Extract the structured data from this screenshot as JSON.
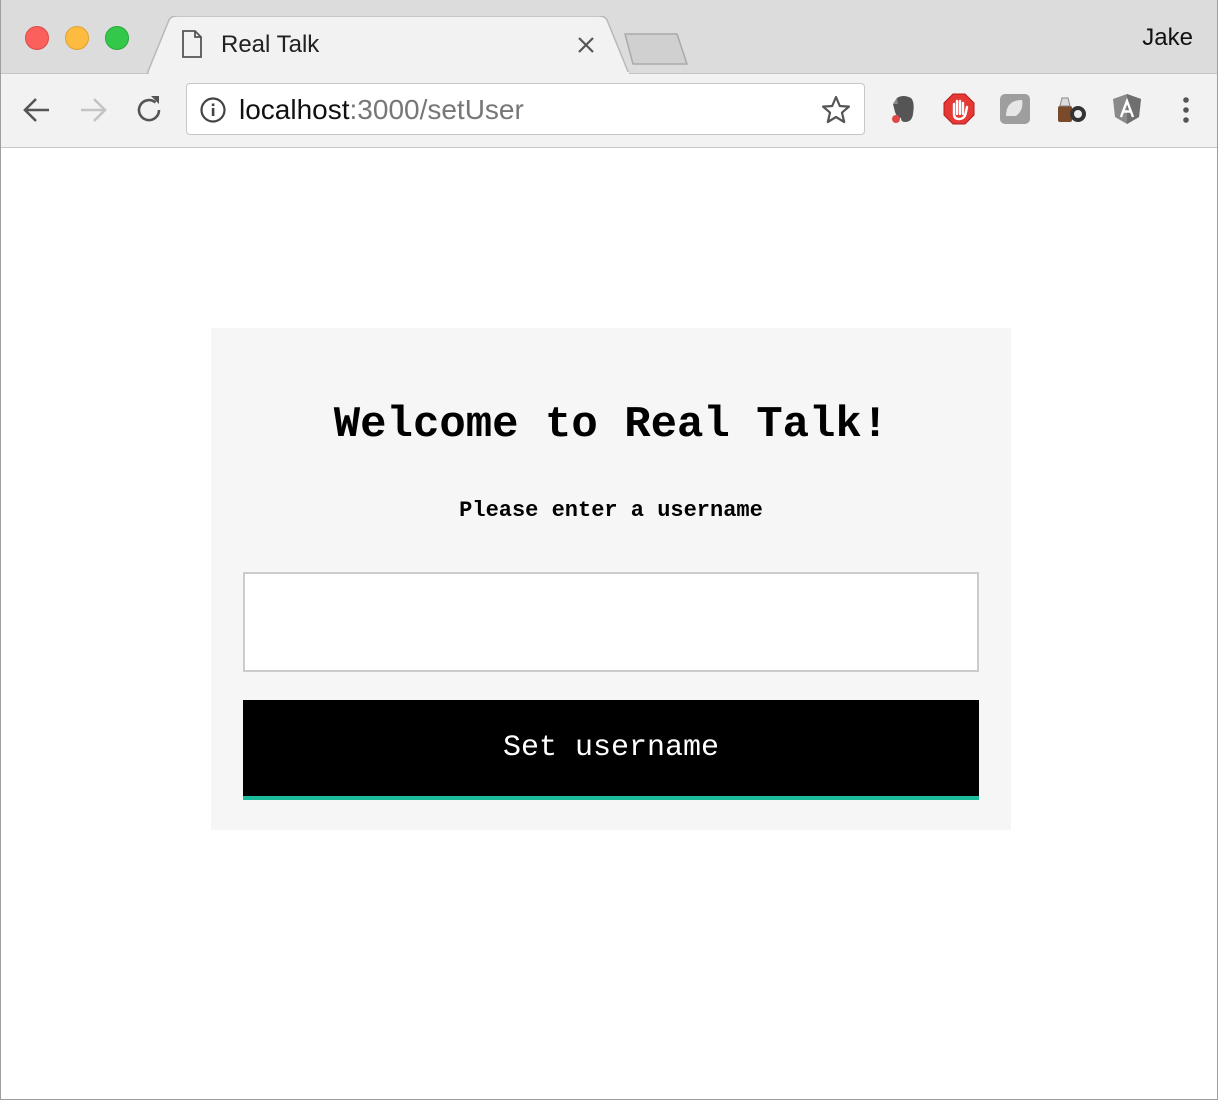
{
  "browser": {
    "tab": {
      "title": "Real Talk"
    },
    "profile_name": "Jake",
    "address_bar": {
      "host": "localhost",
      "path": ":3000/setUser"
    },
    "extensions": [
      "evernote-icon",
      "adblock-icon",
      "extension-gray-icon",
      "camera-extension-icon",
      "angular-icon"
    ]
  },
  "page": {
    "heading": "Welcome to Real Talk!",
    "subheading": "Please enter a username",
    "username_input": {
      "value": "",
      "placeholder": ""
    },
    "submit_label": "Set username"
  },
  "colors": {
    "button_background": "#000000",
    "button_accent": "#1abc9c",
    "card_background": "#f6f6f6"
  }
}
